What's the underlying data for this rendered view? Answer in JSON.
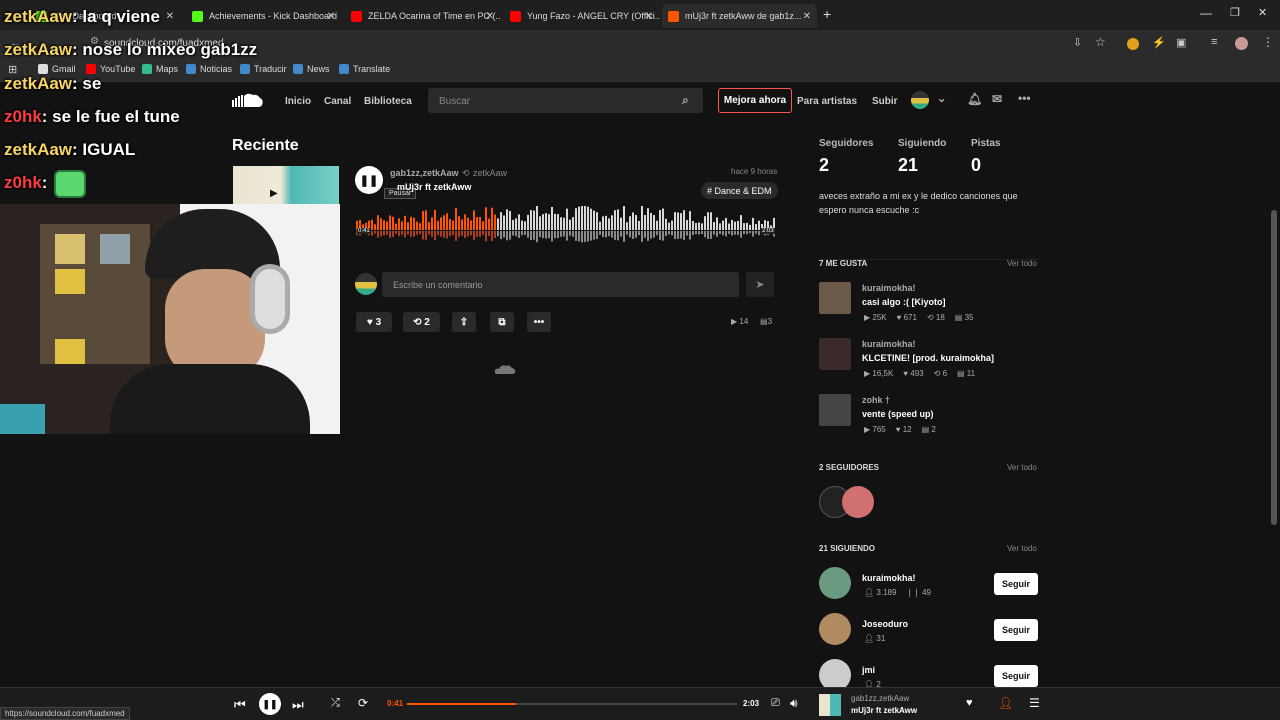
{
  "browser": {
    "tabs": [
      {
        "label": "Kick Dashboard",
        "color": "#53fc18"
      },
      {
        "label": "Achievements - Kick Dashboard",
        "color": "#53fc18"
      },
      {
        "label": "ZELDA Ocarina of Time en PC (...",
        "color": "#ff0000"
      },
      {
        "label": "Yung Fazo - ANGEL CRY (Offici...",
        "color": "#ff0000"
      },
      {
        "label": "mUj3r ft zetkAww de gab1z...",
        "color": "#ff5500"
      }
    ],
    "url": "soundcloud.com/fuadxmed",
    "bookmarks": [
      "Gmail",
      "YouTube",
      "Maps",
      "Noticias",
      "Traducir",
      "News",
      "Translate"
    ]
  },
  "chat": [
    {
      "user": "zetkAaw",
      "msg": ": la q viene",
      "color": "u1"
    },
    {
      "user": "zetkAaw",
      "msg": ": nose lo mixeo gab1zz",
      "color": "u1"
    },
    {
      "user": "zetkAaw",
      "msg": ": se",
      "color": "u1"
    },
    {
      "user": "z0hk",
      "msg": ": se le fue el tune",
      "color": "u2"
    },
    {
      "user": "zetkAaw",
      "msg": ": IGUAL",
      "color": "u1"
    },
    {
      "user": "z0hk",
      "msg": ":",
      "color": "u2"
    }
  ],
  "header": {
    "nav": [
      "Inicio",
      "Canal",
      "Biblioteca"
    ],
    "search_placeholder": "Buscar",
    "upgrade": "Mejora ahora",
    "artists": "Para artistas",
    "upload": "Subir"
  },
  "recent": {
    "title": "Reciente",
    "track": {
      "artist": "gab1zz,zetkAaw",
      "repost_by": "zetkAaw",
      "title": "mUj3r ft zetkAww",
      "time_ago": "hace 9 horas",
      "tag": "# Dance & EDM",
      "pause_tooltip": "Pausar",
      "current": "0:41",
      "duration": "2:03",
      "progress": 0.33,
      "comment_placeholder": "Escribe un comentario",
      "likes": "3",
      "reposts": "2",
      "plays": "14",
      "comments": "3"
    }
  },
  "profile": {
    "stats": [
      {
        "label": "Seguidores",
        "value": "2"
      },
      {
        "label": "Siguiendo",
        "value": "21"
      },
      {
        "label": "Pistas",
        "value": "0"
      }
    ],
    "bio": "aveces extraño a mi ex y le dedico canciones que espero nunca escuche :c"
  },
  "likes_section": {
    "title": "7 ME GUSTA",
    "more": "Ver todo",
    "items": [
      {
        "user": "kuraimokha!",
        "title": "casi algo :( [Kiyoto]",
        "plays": "25K",
        "likes": "671",
        "reposts": "18",
        "comments": "35",
        "color": "#6b5a4a"
      },
      {
        "user": "kuraimokha!",
        "title": "KLCETINE! [prod. kuraimokha]",
        "plays": "16,5K",
        "likes": "493",
        "reposts": "6",
        "comments": "11",
        "color": "#3a2a2a"
      },
      {
        "user": "zohk †",
        "title": "vente (speed up)",
        "plays": "765",
        "likes": "12",
        "reposts": "",
        "comments": "2",
        "color": "#444"
      }
    ]
  },
  "followers_section": {
    "title": "2 SEGUIDORES",
    "more": "Ver todo"
  },
  "following_section": {
    "title": "21 SIGUIENDO",
    "more": "Ver todo",
    "button": "Seguir",
    "items": [
      {
        "name": "kuraimokha!",
        "followers": "3.189",
        "tracks": "49",
        "color": "#6a9a80"
      },
      {
        "name": "Joseoduro",
        "followers": "31",
        "tracks": "",
        "color": "#b08a60"
      },
      {
        "name": "jmi",
        "followers": "2",
        "tracks": "",
        "color": "#ccc"
      }
    ]
  },
  "player": {
    "current": "0:41",
    "duration": "2:03",
    "progress": 0.33,
    "artist": "gab1zz,zetkAaw",
    "title": "mUj3r ft zetkAww"
  },
  "status_url": "https://soundcloud.com/fuadxmed"
}
